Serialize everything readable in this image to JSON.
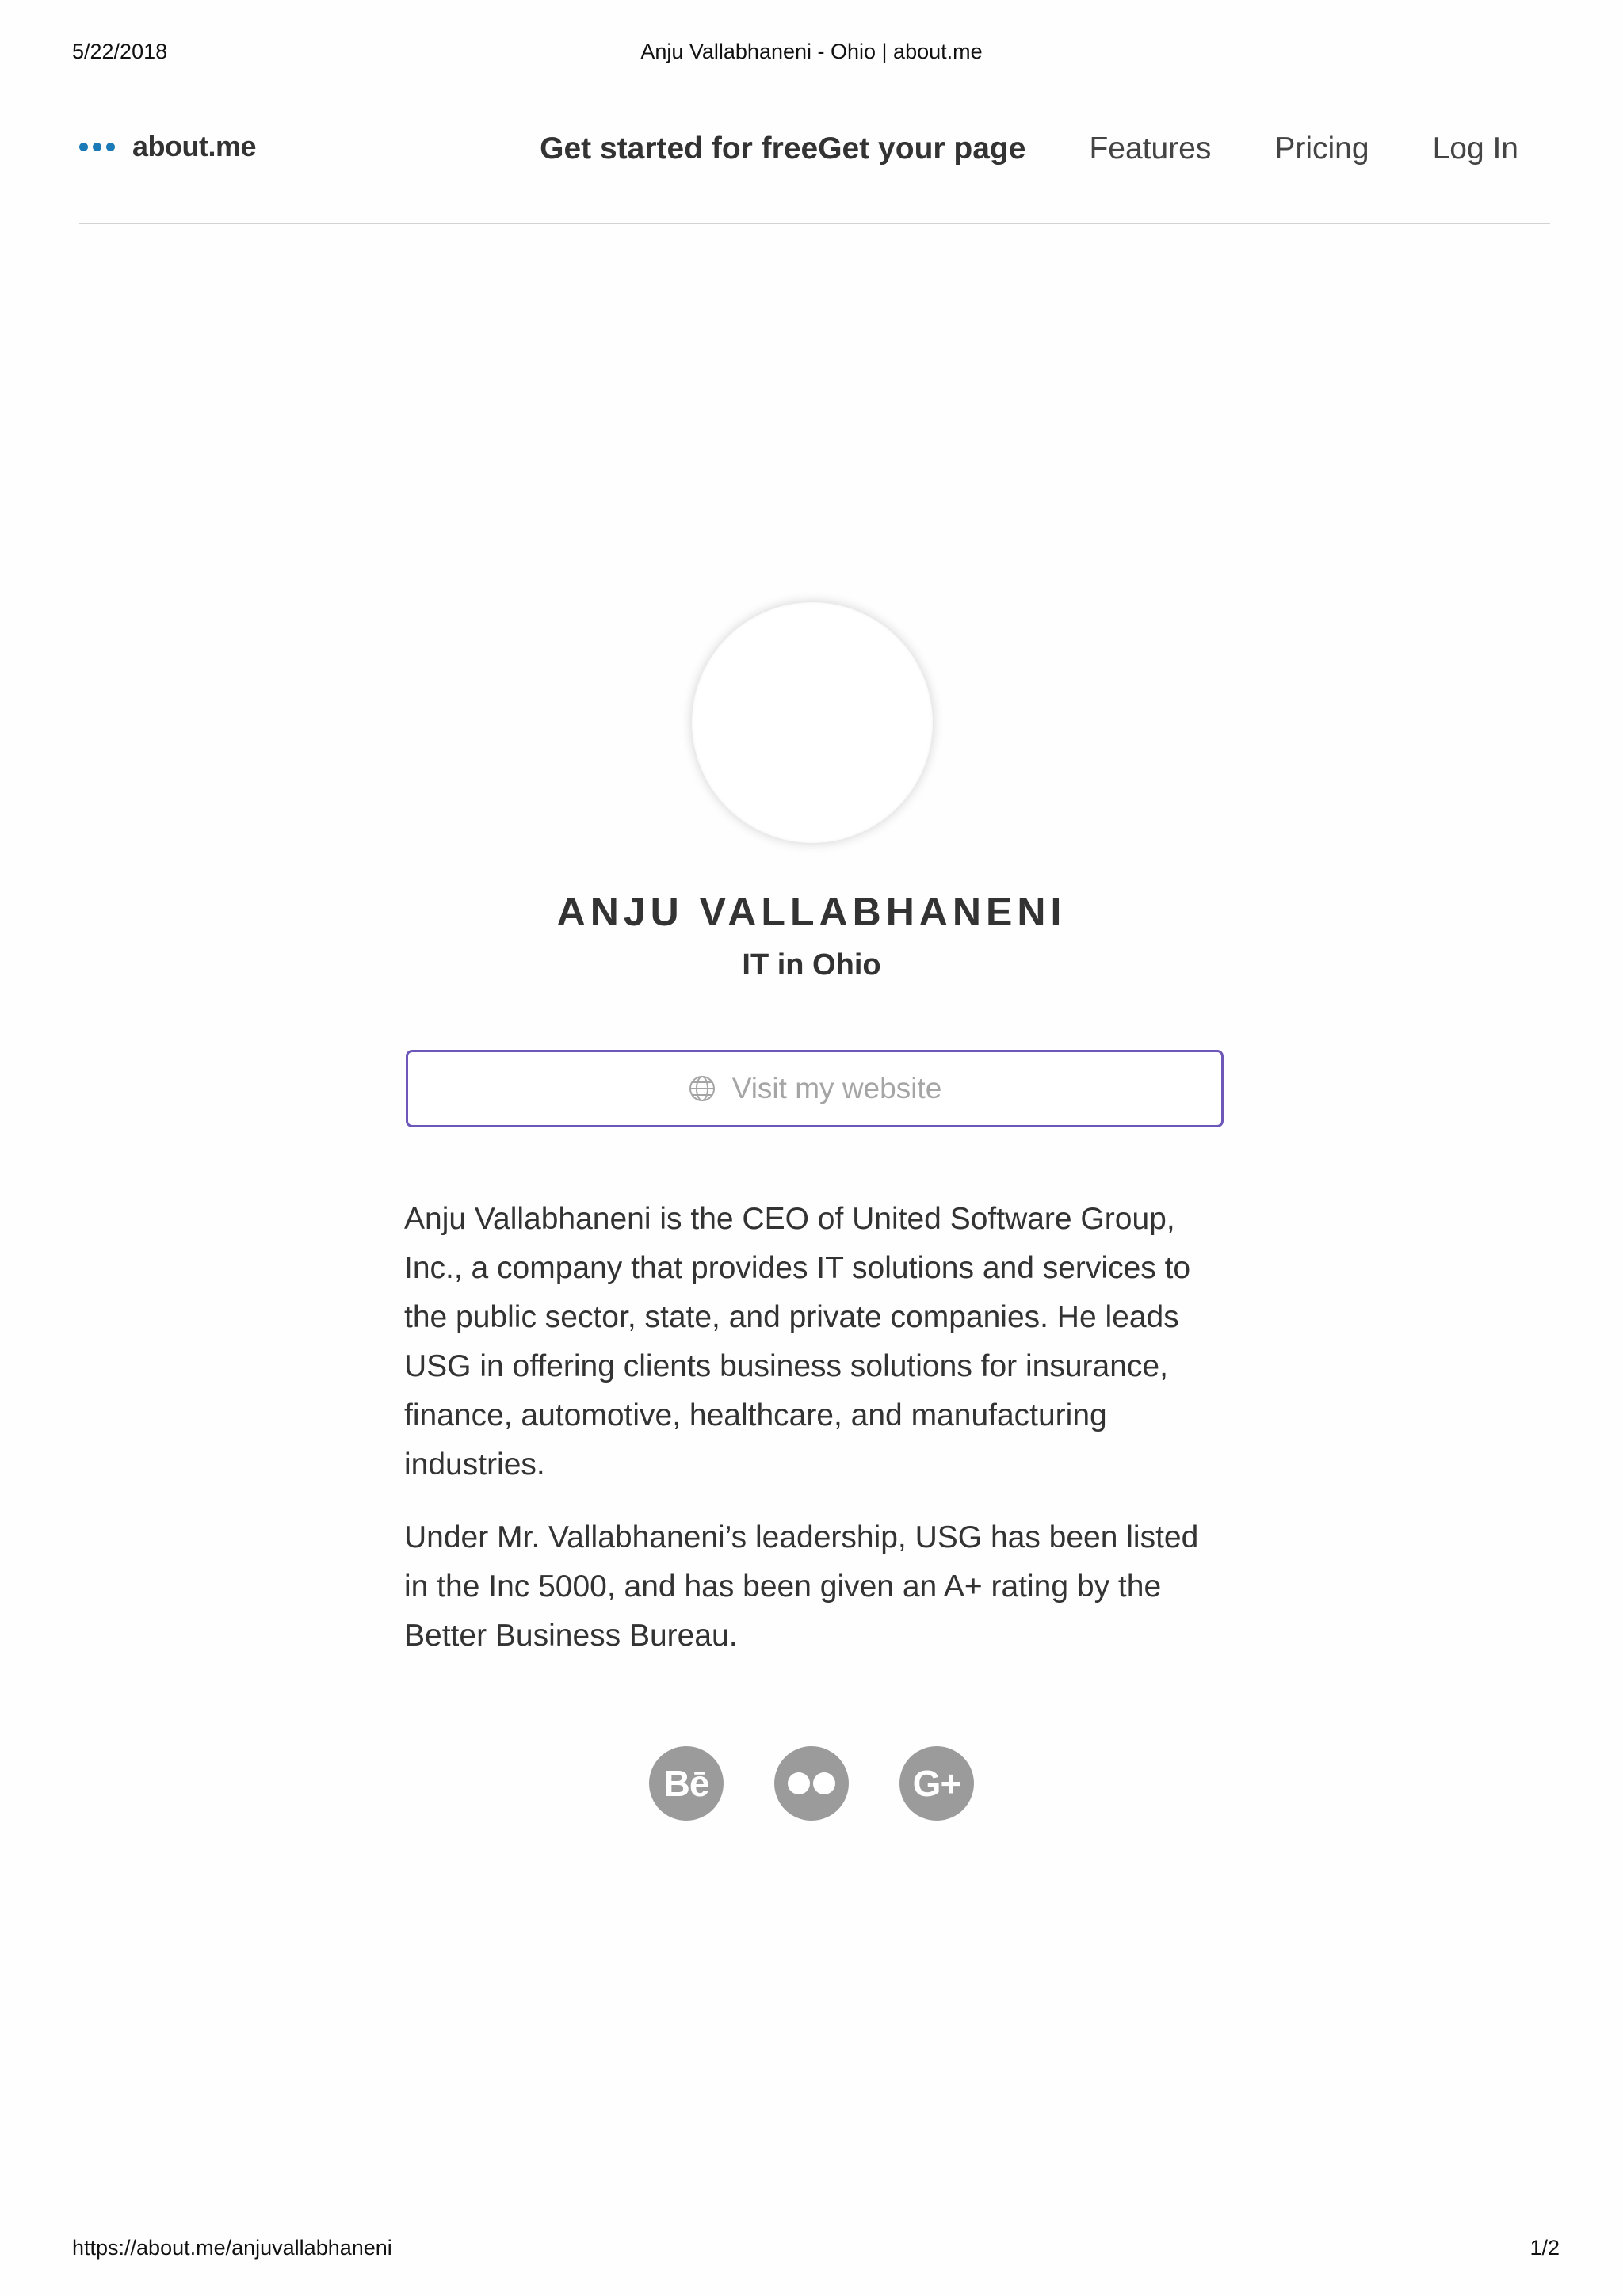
{
  "print": {
    "date": "5/22/2018",
    "title": "Anju Vallabhaneni - Ohio | about.me",
    "url": "https://about.me/anjuvallabhaneni",
    "page": "1/2"
  },
  "nav": {
    "logo_text": "about.me",
    "cta_label": "Get started for freeGet your page",
    "features_label": "Features",
    "pricing_label": "Pricing",
    "login_label": "Log In"
  },
  "profile": {
    "name": "ANJU VALLABHANENI",
    "headline": "IT in Ohio",
    "website_label": "Visit my website",
    "bio": [
      "Anju Vallabhaneni is the CEO of United Software Group, Inc., a company that provides IT solutions and services to the public sector, state, and private companies. He leads USG in offering clients business solutions for insurance, finance, automotive, healthcare, and manufacturing industries.",
      "Under Mr. Vallabhaneni’s leadership, USG has been listed in the Inc 5000, and has been given an A+ rating by the Better Business Bureau."
    ]
  },
  "socials": {
    "behance_glyph": "Bē",
    "googleplus_glyph": "G+",
    "icons": [
      "behance-icon",
      "flickr-icon",
      "google-plus-icon"
    ]
  },
  "colors": {
    "logo_accent": "#1a7ab8",
    "button_border": "#6d57b8",
    "social_bg": "#9b9b9b"
  }
}
